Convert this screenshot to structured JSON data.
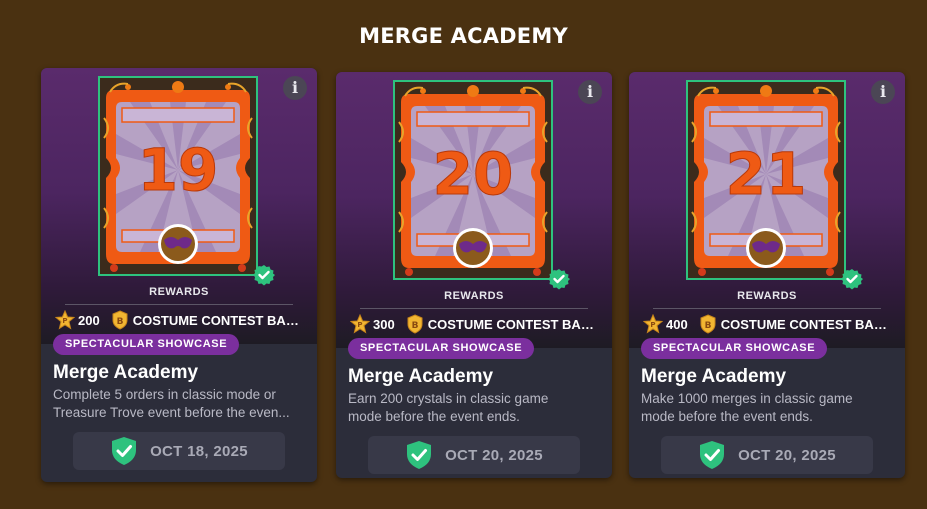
{
  "page": {
    "title": "MERGE ACADEMY"
  },
  "colors": {
    "background": "#4a3111",
    "tag": "#7b2f9e",
    "check": "#2ec27e",
    "ticket_orange": "#ef5a14"
  },
  "cards": [
    {
      "number": "19",
      "rewards_label": "REWARDS",
      "points": "200",
      "badge": "COSTUME CONTEST BAD...",
      "tag": "SPECTACULAR SHOWCASE",
      "title": "Merge Academy",
      "desc_line1": "Complete 5 orders in classic mode or",
      "desc_line2": "Treasure Trove event before the even...",
      "date": "OCT 18, 2025",
      "info_label": "i"
    },
    {
      "number": "20",
      "rewards_label": "REWARDS",
      "points": "300",
      "badge": "COSTUME CONTEST BAD...",
      "tag": "SPECTACULAR SHOWCASE",
      "title": "Merge Academy",
      "desc_line1": "Earn 200 crystals in classic game",
      "desc_line2": "mode before the event ends.",
      "date": "OCT 20, 2025",
      "info_label": "i"
    },
    {
      "number": "21",
      "rewards_label": "REWARDS",
      "points": "400",
      "badge": "COSTUME CONTEST BAD...",
      "tag": "SPECTACULAR SHOWCASE",
      "title": "Merge Academy",
      "desc_line1": "Make 1000 merges in classic game",
      "desc_line2": "mode before the event ends.",
      "date": "OCT 20, 2025",
      "info_label": "i"
    }
  ],
  "icons": {
    "info": "info-icon",
    "points": "star-points-icon",
    "badge": "coin-badge-icon",
    "completed": "shield-check-icon",
    "ticket_check": "check-circle-icon",
    "ticket_emblem": "masquerade-mask-icon"
  }
}
